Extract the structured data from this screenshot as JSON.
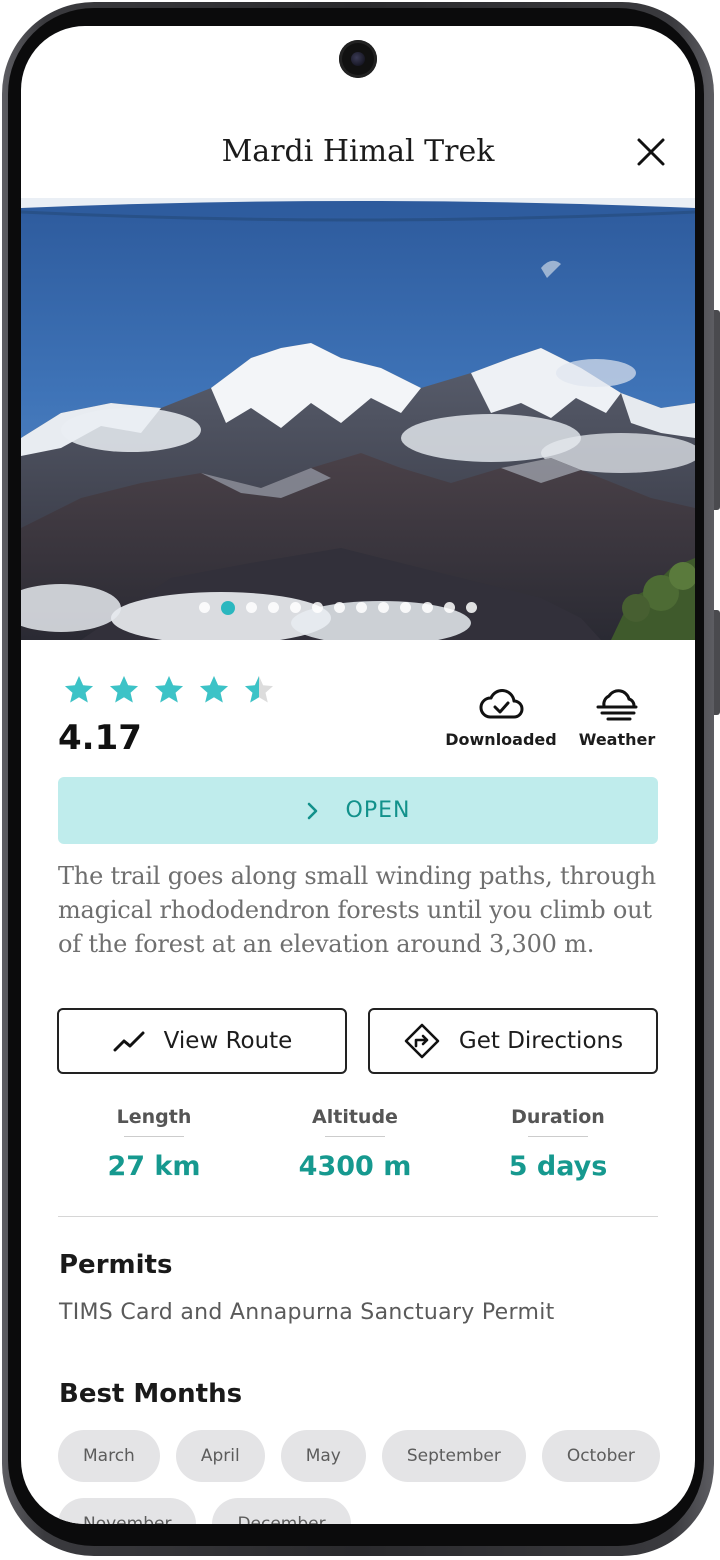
{
  "header": {
    "title": "Mardi Himal Trek",
    "close_icon": "close-icon"
  },
  "gallery": {
    "dot_count": 13,
    "active_index": 1
  },
  "rating": {
    "value": "4.17",
    "stars_filled": 4,
    "star_partial_fraction": 0.5,
    "star_color": "#3cc3c7"
  },
  "status": {
    "downloaded_label": "Downloaded",
    "downloaded_icon": "cloud-check-icon",
    "weather_label": "Weather",
    "weather_icon": "fog-cloud-icon"
  },
  "open_button": {
    "label": "OPEN",
    "icon": "chevron-right-icon"
  },
  "description": "The trail goes along small winding paths, through magical rhododendron forests until you climb out of the forest at an elevation around 3,300 m.",
  "actions": {
    "view_route_label": "View Route",
    "view_route_icon": "route-trend-icon",
    "directions_label": "Get Directions",
    "directions_icon": "directions-sign-icon"
  },
  "stats": {
    "length_label": "Length",
    "length_value": "27 km",
    "altitude_label": "Altitude",
    "altitude_value": "4300 m",
    "duration_label": "Duration",
    "duration_value": "5 days"
  },
  "permits": {
    "title": "Permits",
    "text": "TIMS Card and Annapurna Sanctuary Permit"
  },
  "best_months": {
    "title": "Best Months",
    "months": [
      "March",
      "April",
      "May",
      "September",
      "October",
      "November",
      "December"
    ]
  },
  "colors": {
    "accent": "#16998f",
    "open_bg": "#bfecec",
    "chip_bg": "#e4e4e6"
  }
}
